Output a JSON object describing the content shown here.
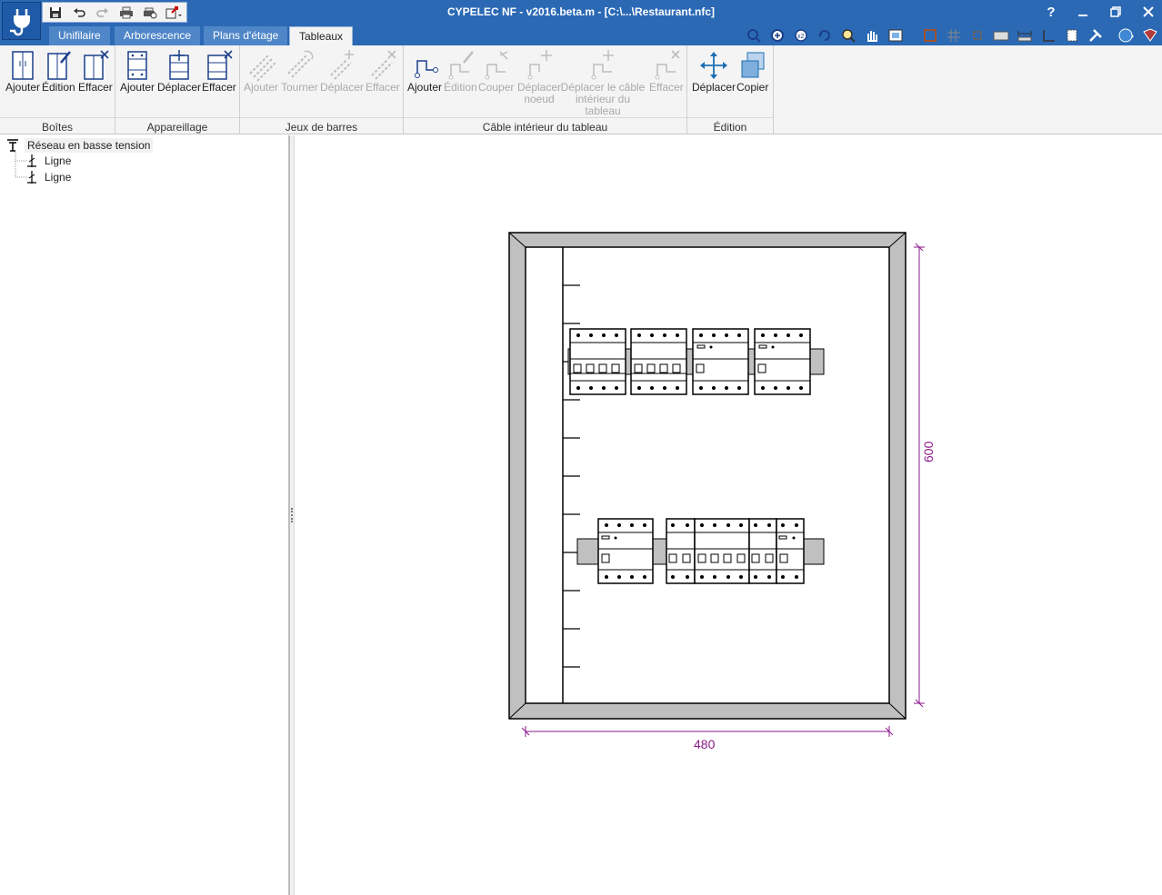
{
  "window": {
    "title": "CYPELEC NF - v2016.beta.m - [C:\\...\\Restaurant.nfc]",
    "help": "?"
  },
  "tabs": [
    {
      "label": "Unifilaire"
    },
    {
      "label": "Arborescence"
    },
    {
      "label": "Plans d'étage"
    },
    {
      "label": "Tableaux"
    }
  ],
  "ribbon": {
    "groups": {
      "boites": {
        "label": "Boîtes",
        "buttons": [
          "Ajouter",
          "Édition",
          "Effacer"
        ]
      },
      "appareillage": {
        "label": "Appareillage",
        "buttons": [
          "Ajouter",
          "Déplacer",
          "Effacer"
        ]
      },
      "jeux": {
        "label": "Jeux de barres",
        "buttons": [
          "Ajouter",
          "Tourner",
          "Déplacer",
          "Effacer"
        ]
      },
      "cable": {
        "label": "Câble intérieur du tableau",
        "buttons": [
          "Ajouter",
          "Édition",
          "Couper",
          "Déplacer noeud",
          "Déplacer le câble intérieur du tableau",
          "Effacer"
        ]
      },
      "edition": {
        "label": "Édition",
        "buttons": [
          "Déplacer",
          "Copier"
        ]
      }
    }
  },
  "tree": {
    "root": "Réseau en basse tension",
    "children": [
      "Ligne",
      "Ligne"
    ]
  },
  "drawing": {
    "dim_height": "600",
    "dim_width": "480"
  },
  "colors": {
    "title_blue": "#2b69b5",
    "dimension": "#8a1a8a",
    "enclosure_frame": "#c0c0c0"
  }
}
